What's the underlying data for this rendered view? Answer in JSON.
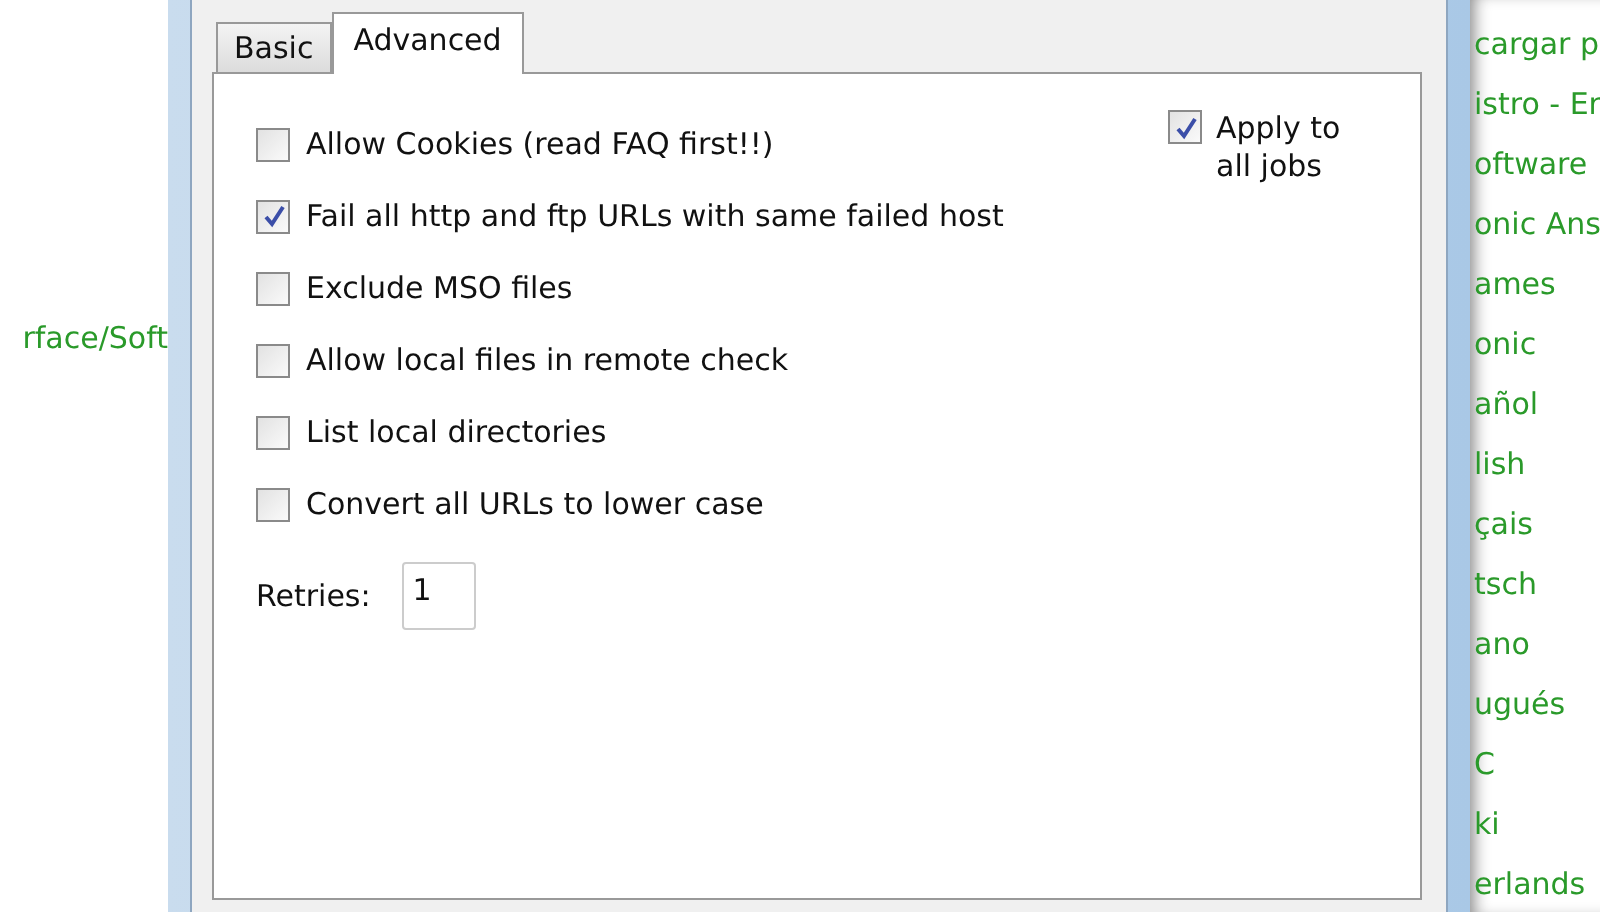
{
  "background_page_left": {
    "text": "rface/Soft"
  },
  "dialog": {
    "tabs": [
      {
        "label": "Basic",
        "selected": false
      },
      {
        "label": "Advanced",
        "selected": true
      }
    ],
    "options": [
      {
        "label": "Allow Cookies (read FAQ first!!)",
        "checked": false
      },
      {
        "label": "Fail all http and ftp URLs with same failed host",
        "checked": true
      },
      {
        "label": "Exclude MSO files",
        "checked": false
      },
      {
        "label": "Allow local files in remote check",
        "checked": false
      },
      {
        "label": "List local directories",
        "checked": false
      },
      {
        "label": "Convert all URLs to lower case",
        "checked": false
      }
    ],
    "apply_to_all": {
      "label": "Apply to all jobs",
      "checked": true
    },
    "retries": {
      "label": "Retries:",
      "value": "1"
    }
  },
  "background_page_right": {
    "links": [
      "cargar p",
      "istro - Er",
      "oftware",
      "onic Ans",
      "ames",
      "onic",
      "añol",
      "lish",
      "çais",
      "tsch",
      "ano",
      "ugués",
      "C",
      "ki",
      "erlands"
    ]
  }
}
